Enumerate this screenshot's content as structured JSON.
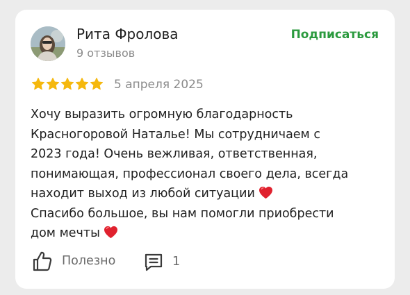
{
  "author": {
    "name": "Рита Фролова",
    "reviews_count": "9 отзывов",
    "avatar_icon": "user-photo"
  },
  "subscribe_label": "Подписаться",
  "rating": {
    "stars": 5,
    "max": 5,
    "star_color": "#f5b80e"
  },
  "review_date": "5 апреля 2025",
  "review_lines": [
    "Хочу выразить огромную благодарность",
    "Красногоровой Наталье! Мы сотрудничаем с",
    "2023 года! Очень вежливая, ответственная,",
    "понимающая, профессионал своего дела, всегда",
    "находит выход из любой ситуации",
    "Спасибо большое, вы нам помогли приобрести",
    "дом мечты"
  ],
  "actions": {
    "helpful_label": "Полезно",
    "helpful_icon": "thumbs-up-icon",
    "comments_count": "1",
    "comments_icon": "comment-icon"
  },
  "colors": {
    "accent_green": "#2b9a3e",
    "heart_red": "#e0212e"
  }
}
